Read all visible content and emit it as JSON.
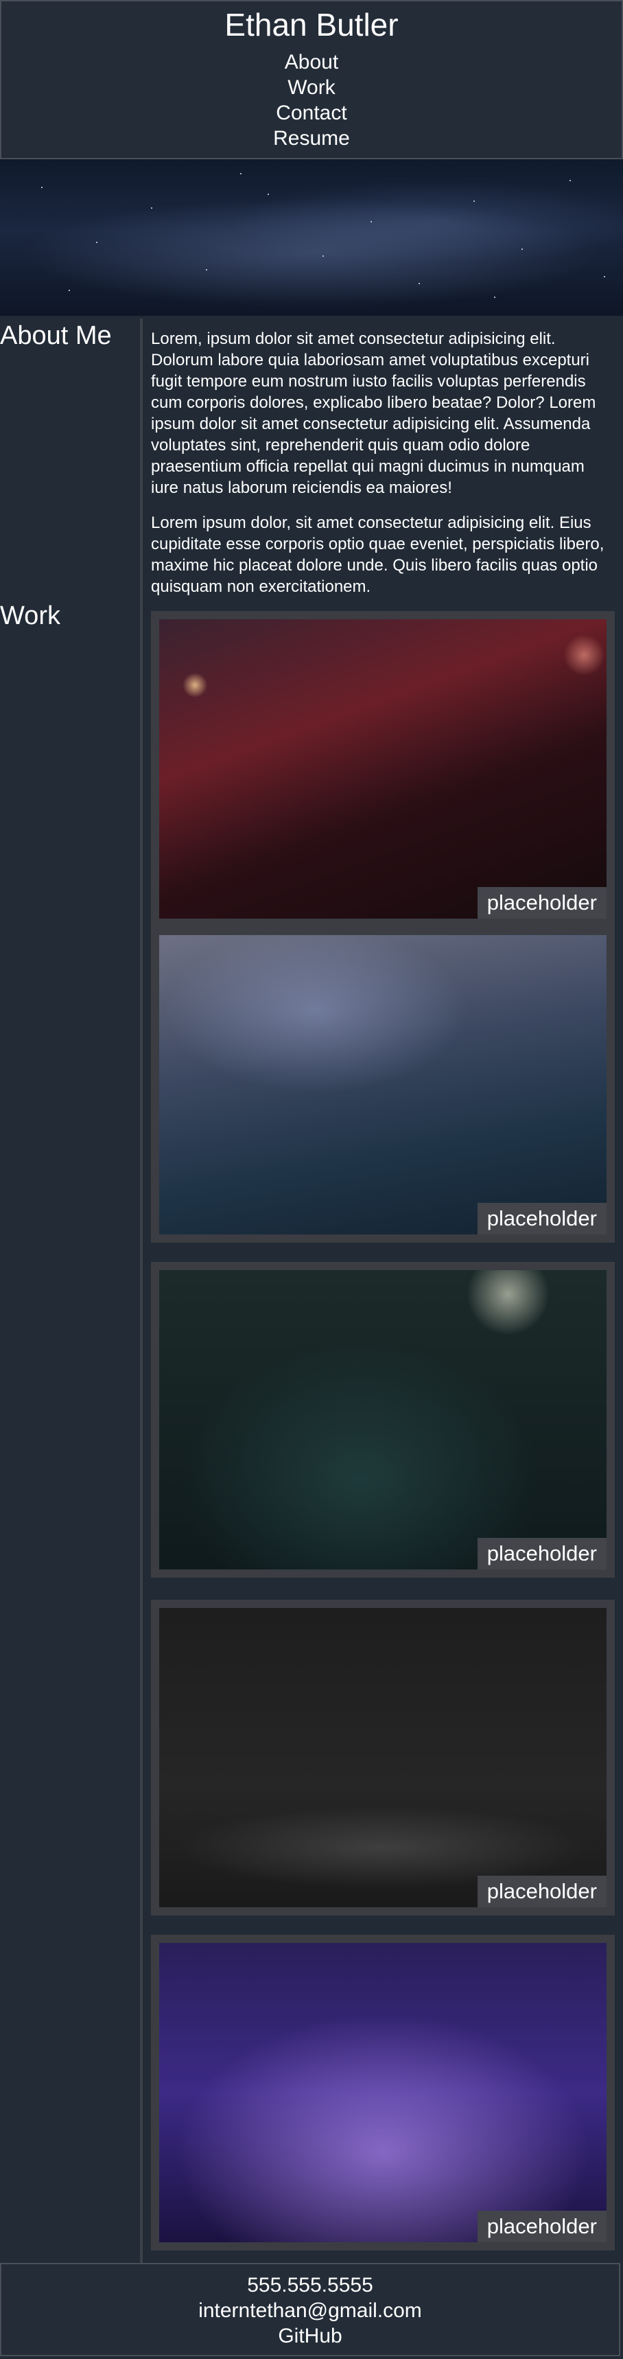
{
  "header": {
    "title": "Ethan Butler",
    "nav": [
      "About",
      "Work",
      "Contact",
      "Resume"
    ]
  },
  "hero": {
    "alt": "starry night sky banner"
  },
  "sidebar": {
    "about_heading": "About Me",
    "work_heading": "Work"
  },
  "about": {
    "paragraphs": [
      "Lorem, ipsum dolor sit amet consectetur adipisicing elit. Dolorum labore quia laboriosam amet voluptatibus excepturi fugit tempore eum nostrum iusto facilis voluptas perferendis cum corporis dolores, explicabo libero beatae? Dolor? Lorem ipsum dolor sit amet consectetur adipisicing elit. Assumenda voluptates sint, reprehenderit quis quam odio dolore praesentium officia repellat qui magni ducimus in numquam iure natus laborum reiciendis ea maiores!",
      "Lorem ipsum dolor, sit amet consectetur adipisicing elit. Eius cupiditate esse corporis optio quae eveniet, perspiciatis libero, maxime hic placeat dolore unde. Quis libero facilis quas optio quisquam non exercitationem."
    ]
  },
  "work": {
    "items": [
      {
        "caption": "placeholder"
      },
      {
        "caption": "placeholder"
      },
      {
        "caption": "placeholder"
      },
      {
        "caption": "placeholder"
      },
      {
        "caption": "placeholder"
      }
    ]
  },
  "footer": {
    "phone": "555.555.5555",
    "email": "interntethan@gmail.com",
    "github": "GitHub"
  }
}
